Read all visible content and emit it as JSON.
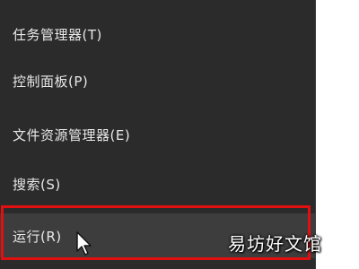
{
  "menu": {
    "items": [
      {
        "label": "任务管理器(T)"
      },
      {
        "label": "控制面板(P)"
      },
      {
        "label": "文件资源管理器(E)"
      },
      {
        "label": "搜索(S)"
      },
      {
        "label": "运行(R)"
      }
    ]
  },
  "highlighted_item": "运行(R)",
  "colors": {
    "menu_background": "#2b2b2b",
    "hover_background": "#3d3d3d",
    "menu_text": "#e8e8e8",
    "highlight_border": "#e01010"
  },
  "icons": {
    "cursor": "mouse-pointer-icon"
  },
  "watermark": "易坊好文馆"
}
